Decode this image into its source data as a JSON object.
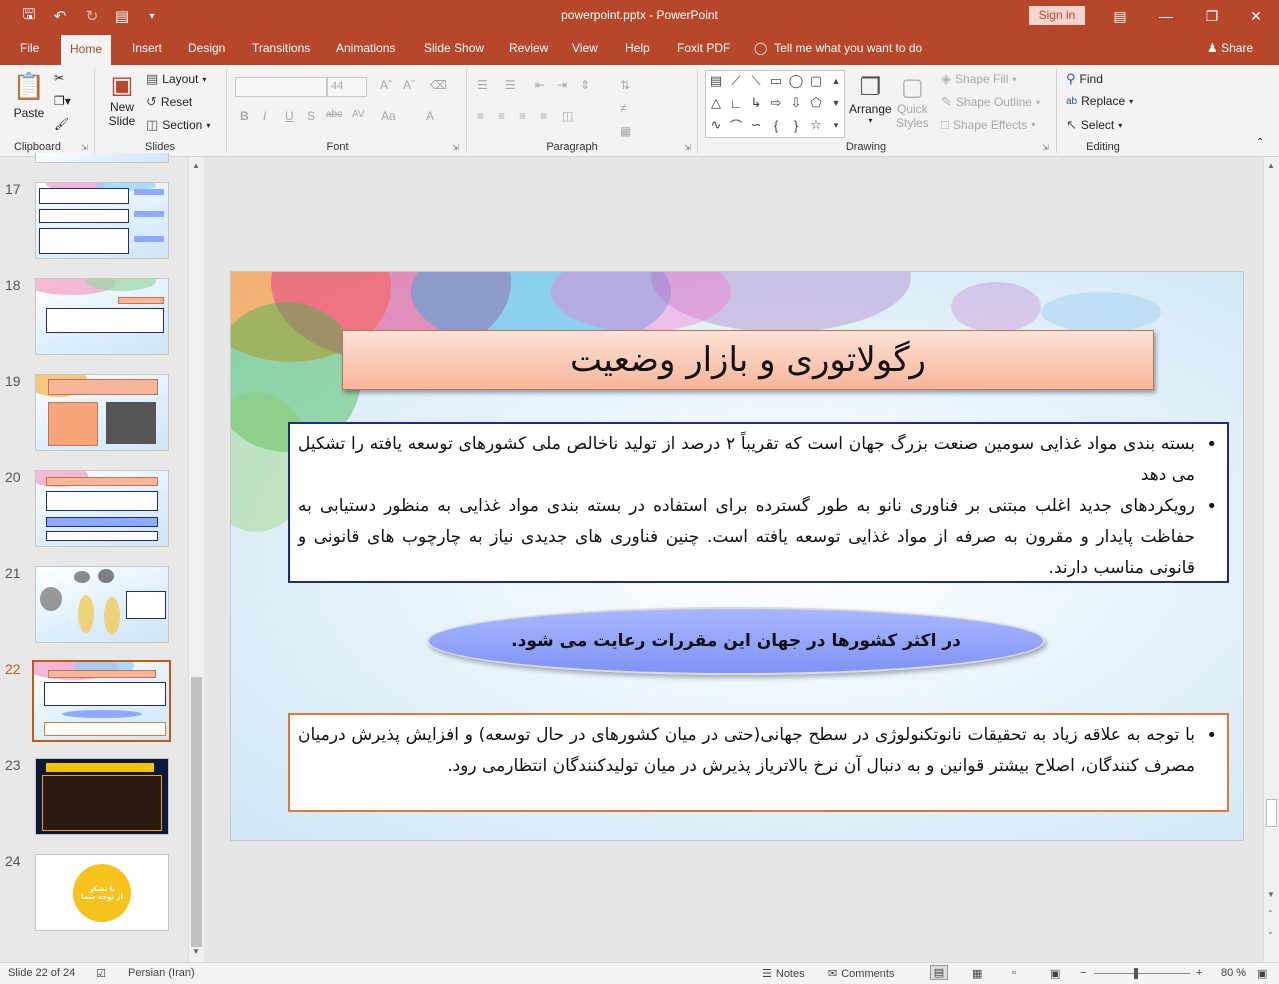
{
  "window": {
    "title": "powerpoint.pptx  -  PowerPoint",
    "sign_in": "Sign in",
    "accent": "#b7472a"
  },
  "tabs": [
    "File",
    "Home",
    "Insert",
    "Design",
    "Transitions",
    "Animations",
    "Slide Show",
    "Review",
    "View",
    "Help",
    "Foxit PDF"
  ],
  "active_tab": "Home",
  "tell_me": "Tell me what you want to do",
  "share": "Share",
  "ribbon": {
    "clipboard": {
      "label": "Clipboard",
      "paste": "Paste"
    },
    "slides": {
      "label": "Slides",
      "new_slide_1": "New",
      "new_slide_2": "Slide",
      "layout": "Layout",
      "reset": "Reset",
      "section": "Section"
    },
    "font": {
      "label": "Font",
      "size": "44"
    },
    "paragraph": {
      "label": "Paragraph"
    },
    "drawing": {
      "label": "Drawing",
      "arrange": "Arrange",
      "quick_styles_1": "Quick",
      "quick_styles_2": "Styles",
      "shape_fill": "Shape Fill",
      "shape_outline": "Shape Outline",
      "shape_effects": "Shape Effects"
    },
    "editing": {
      "label": "Editing",
      "find": "Find",
      "replace": "Replace",
      "select": "Select"
    }
  },
  "thumbnails": [
    {
      "num": "17"
    },
    {
      "num": "18"
    },
    {
      "num": "19"
    },
    {
      "num": "20"
    },
    {
      "num": "21"
    },
    {
      "num": "22",
      "selected": true
    },
    {
      "num": "23"
    },
    {
      "num": "24",
      "text_1": "با تشکر",
      "text_2": "از توجه شما"
    }
  ],
  "slide": {
    "title": "رگولاتوری و بازار وضعیت",
    "box1": [
      "بسته بندی مواد غذایی سومین صنعت بزرگ جهان است که تقریباً ۲ درصد از تولید ناخالص ملی کشورهای توسعه یافته را تشکیل می دهد",
      "رویکردهای جدید اغلب مبتنی بر فناوری نانو به طور گسترده برای استفاده در بسته بندی مواد غذایی به منظور دستیابی به حفاظت پایدار و مقرون به صرفه از مواد غذایی توسعه یافته است. چنین فناوری های جدیدی نیاز به چارچوب های قانونی و قانونی مناسب دارند."
    ],
    "oval": "در اکثر کشورها در جهان این مقررات رعایت می شود.",
    "box2": [
      "با توجه به علاقه زیاد به تحقیقات نانوتکنولوژی در سطح جهانی(حتی در میان کشورهای در حال توسعه) و افزایش پذیرش درمیان مصرف کنندگان، اصلاح بیشتر قوانین و به دنبال آن نرخ بالاتریاز پذیرش در میان تولیدکنندگان انتظارمی رود."
    ]
  },
  "status": {
    "slide_info": "Slide 22 of 24",
    "language": "Persian (Iran)",
    "notes": "Notes",
    "comments": "Comments",
    "zoom": "80 %"
  }
}
